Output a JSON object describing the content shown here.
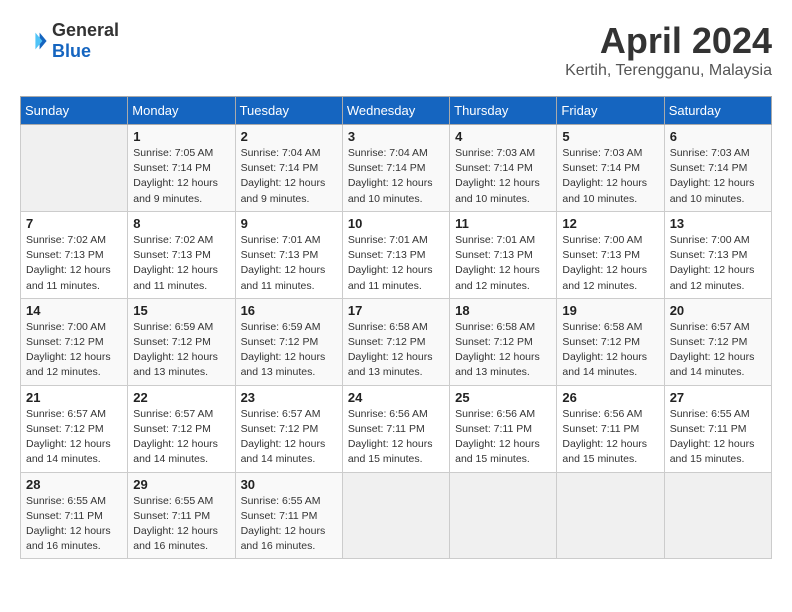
{
  "logo": {
    "general": "General",
    "blue": "Blue"
  },
  "title": "April 2024",
  "location": "Kertih, Terengganu, Malaysia",
  "days_of_week": [
    "Sunday",
    "Monday",
    "Tuesday",
    "Wednesday",
    "Thursday",
    "Friday",
    "Saturday"
  ],
  "weeks": [
    [
      {
        "day": "",
        "info": ""
      },
      {
        "day": "1",
        "info": "Sunrise: 7:05 AM\nSunset: 7:14 PM\nDaylight: 12 hours\nand 9 minutes."
      },
      {
        "day": "2",
        "info": "Sunrise: 7:04 AM\nSunset: 7:14 PM\nDaylight: 12 hours\nand 9 minutes."
      },
      {
        "day": "3",
        "info": "Sunrise: 7:04 AM\nSunset: 7:14 PM\nDaylight: 12 hours\nand 10 minutes."
      },
      {
        "day": "4",
        "info": "Sunrise: 7:03 AM\nSunset: 7:14 PM\nDaylight: 12 hours\nand 10 minutes."
      },
      {
        "day": "5",
        "info": "Sunrise: 7:03 AM\nSunset: 7:14 PM\nDaylight: 12 hours\nand 10 minutes."
      },
      {
        "day": "6",
        "info": "Sunrise: 7:03 AM\nSunset: 7:14 PM\nDaylight: 12 hours\nand 10 minutes."
      }
    ],
    [
      {
        "day": "7",
        "info": "Sunrise: 7:02 AM\nSunset: 7:13 PM\nDaylight: 12 hours\nand 11 minutes."
      },
      {
        "day": "8",
        "info": "Sunrise: 7:02 AM\nSunset: 7:13 PM\nDaylight: 12 hours\nand 11 minutes."
      },
      {
        "day": "9",
        "info": "Sunrise: 7:01 AM\nSunset: 7:13 PM\nDaylight: 12 hours\nand 11 minutes."
      },
      {
        "day": "10",
        "info": "Sunrise: 7:01 AM\nSunset: 7:13 PM\nDaylight: 12 hours\nand 11 minutes."
      },
      {
        "day": "11",
        "info": "Sunrise: 7:01 AM\nSunset: 7:13 PM\nDaylight: 12 hours\nand 12 minutes."
      },
      {
        "day": "12",
        "info": "Sunrise: 7:00 AM\nSunset: 7:13 PM\nDaylight: 12 hours\nand 12 minutes."
      },
      {
        "day": "13",
        "info": "Sunrise: 7:00 AM\nSunset: 7:13 PM\nDaylight: 12 hours\nand 12 minutes."
      }
    ],
    [
      {
        "day": "14",
        "info": "Sunrise: 7:00 AM\nSunset: 7:12 PM\nDaylight: 12 hours\nand 12 minutes."
      },
      {
        "day": "15",
        "info": "Sunrise: 6:59 AM\nSunset: 7:12 PM\nDaylight: 12 hours\nand 13 minutes."
      },
      {
        "day": "16",
        "info": "Sunrise: 6:59 AM\nSunset: 7:12 PM\nDaylight: 12 hours\nand 13 minutes."
      },
      {
        "day": "17",
        "info": "Sunrise: 6:58 AM\nSunset: 7:12 PM\nDaylight: 12 hours\nand 13 minutes."
      },
      {
        "day": "18",
        "info": "Sunrise: 6:58 AM\nSunset: 7:12 PM\nDaylight: 12 hours\nand 13 minutes."
      },
      {
        "day": "19",
        "info": "Sunrise: 6:58 AM\nSunset: 7:12 PM\nDaylight: 12 hours\nand 14 minutes."
      },
      {
        "day": "20",
        "info": "Sunrise: 6:57 AM\nSunset: 7:12 PM\nDaylight: 12 hours\nand 14 minutes."
      }
    ],
    [
      {
        "day": "21",
        "info": "Sunrise: 6:57 AM\nSunset: 7:12 PM\nDaylight: 12 hours\nand 14 minutes."
      },
      {
        "day": "22",
        "info": "Sunrise: 6:57 AM\nSunset: 7:12 PM\nDaylight: 12 hours\nand 14 minutes."
      },
      {
        "day": "23",
        "info": "Sunrise: 6:57 AM\nSunset: 7:12 PM\nDaylight: 12 hours\nand 14 minutes."
      },
      {
        "day": "24",
        "info": "Sunrise: 6:56 AM\nSunset: 7:11 PM\nDaylight: 12 hours\nand 15 minutes."
      },
      {
        "day": "25",
        "info": "Sunrise: 6:56 AM\nSunset: 7:11 PM\nDaylight: 12 hours\nand 15 minutes."
      },
      {
        "day": "26",
        "info": "Sunrise: 6:56 AM\nSunset: 7:11 PM\nDaylight: 12 hours\nand 15 minutes."
      },
      {
        "day": "27",
        "info": "Sunrise: 6:55 AM\nSunset: 7:11 PM\nDaylight: 12 hours\nand 15 minutes."
      }
    ],
    [
      {
        "day": "28",
        "info": "Sunrise: 6:55 AM\nSunset: 7:11 PM\nDaylight: 12 hours\nand 16 minutes."
      },
      {
        "day": "29",
        "info": "Sunrise: 6:55 AM\nSunset: 7:11 PM\nDaylight: 12 hours\nand 16 minutes."
      },
      {
        "day": "30",
        "info": "Sunrise: 6:55 AM\nSunset: 7:11 PM\nDaylight: 12 hours\nand 16 minutes."
      },
      {
        "day": "",
        "info": ""
      },
      {
        "day": "",
        "info": ""
      },
      {
        "day": "",
        "info": ""
      },
      {
        "day": "",
        "info": ""
      }
    ]
  ]
}
